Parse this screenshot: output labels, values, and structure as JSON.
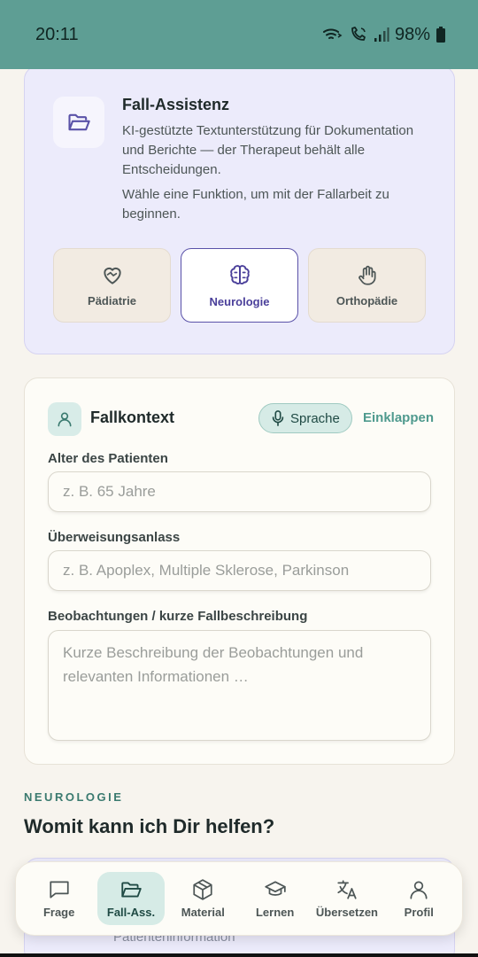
{
  "status_bar": {
    "time": "20:11",
    "battery": "98%",
    "icons": [
      "wifi-calling-icon",
      "volte-call-icon",
      "signal-icon",
      "battery-icon"
    ]
  },
  "intro": {
    "icon": "folder-open-icon",
    "title": "Fall-Assistenz",
    "description": "KI-gestützte Textunterstützung für Dokumentation und Berichte — der Therapeut behält alle Entscheidungen.",
    "hint": "Wähle eine Funktion, um mit der Fallarbeit zu beginnen.",
    "specialties": [
      {
        "label": "Pädiatrie",
        "icon": "heart-handshake-icon",
        "selected": false
      },
      {
        "label": "Neurologie",
        "icon": "brain-icon",
        "selected": true
      },
      {
        "label": "Orthopädie",
        "icon": "hand-icon",
        "selected": false
      }
    ]
  },
  "context": {
    "title": "Fallkontext",
    "icon": "user-icon",
    "voice_label": "Sprache",
    "collapse_label": "Einklappen",
    "fields": {
      "age_label": "Alter des Patienten",
      "age_placeholder": "z. B. 65 Jahre",
      "referral_label": "Überweisungsanlass",
      "referral_placeholder": "z. B. Apoplex, Multiple Sklerose, Parkinson",
      "notes_label": "Beobachtungen / kurze Fallbeschreibung",
      "notes_placeholder": "Kurze Beschreibung der Beobachtungen und relevanten Informationen …"
    }
  },
  "section": {
    "kicker": "NEUROLOGIE",
    "title": "Womit kann ich Dir helfen?",
    "peek_text": "Patienteninformation"
  },
  "nav": [
    {
      "label": "Frage",
      "icon": "chat-icon",
      "active": false
    },
    {
      "label": "Fall-Ass.",
      "icon": "folder-open-icon",
      "active": true
    },
    {
      "label": "Material",
      "icon": "box-icon",
      "active": false
    },
    {
      "label": "Lernen",
      "icon": "graduation-cap-icon",
      "active": false
    },
    {
      "label": "Übersetzen",
      "icon": "translate-icon",
      "active": false
    },
    {
      "label": "Profil",
      "icon": "user-icon",
      "active": false
    }
  ]
}
